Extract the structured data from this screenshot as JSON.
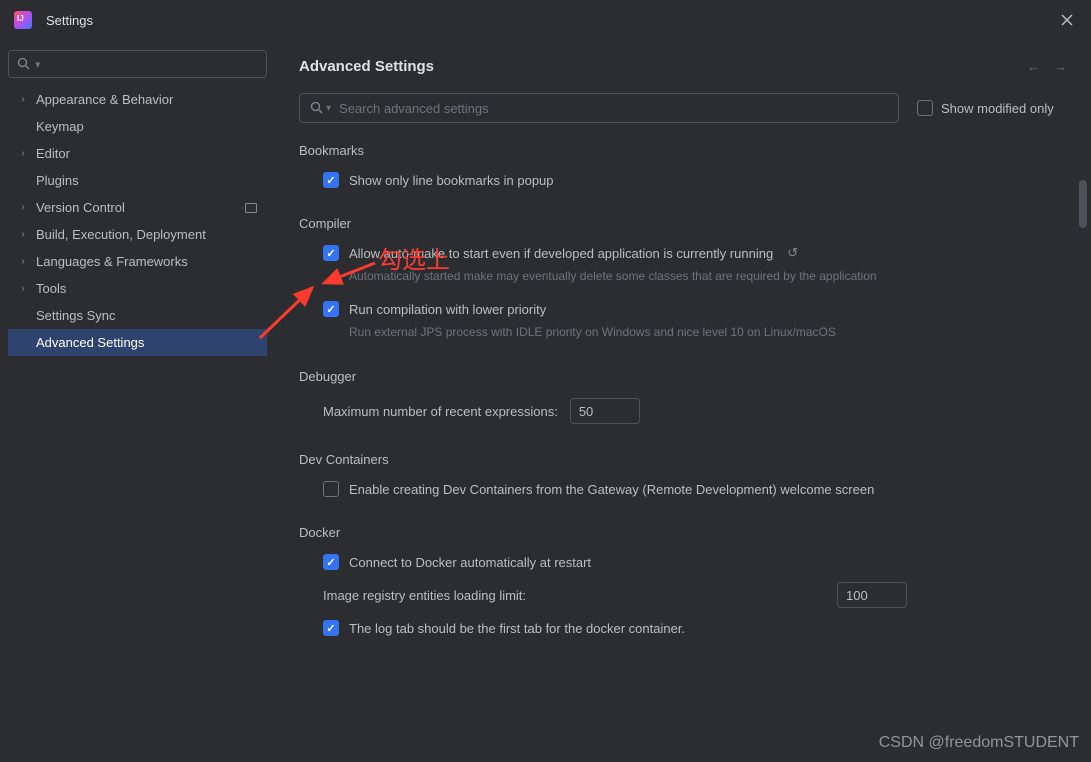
{
  "window": {
    "title": "Settings"
  },
  "sidebar": {
    "items": [
      {
        "label": "Appearance & Behavior",
        "expandable": true
      },
      {
        "label": "Keymap",
        "expandable": false
      },
      {
        "label": "Editor",
        "expandable": true
      },
      {
        "label": "Plugins",
        "expandable": false
      },
      {
        "label": "Version Control",
        "expandable": true,
        "badge": true
      },
      {
        "label": "Build, Execution, Deployment",
        "expandable": true
      },
      {
        "label": "Languages & Frameworks",
        "expandable": true
      },
      {
        "label": "Tools",
        "expandable": true
      },
      {
        "label": "Settings Sync",
        "expandable": false
      },
      {
        "label": "Advanced Settings",
        "expandable": false,
        "selected": true
      }
    ]
  },
  "content": {
    "title": "Advanced Settings",
    "search_placeholder": "Search advanced settings",
    "show_modified_only": "Show modified only",
    "sections": {
      "bookmarks": {
        "title": "Bookmarks",
        "show_line_bookmarks": "Show only line bookmarks in popup"
      },
      "compiler": {
        "title": "Compiler",
        "auto_make": "Allow auto-make to start even if developed application is currently running",
        "auto_make_hint": "Automatically started make may eventually delete some classes that are required by the application",
        "lower_priority": "Run compilation with lower priority",
        "lower_priority_hint": "Run external JPS process with IDLE priority on Windows and nice level 10 on Linux/macOS"
      },
      "debugger": {
        "title": "Debugger",
        "max_expr_label": "Maximum number of recent expressions:",
        "max_expr_value": "50"
      },
      "dev_containers": {
        "title": "Dev Containers",
        "enable_creating": "Enable creating Dev Containers from the Gateway (Remote Development) welcome screen"
      },
      "docker": {
        "title": "Docker",
        "connect_auto": "Connect to Docker automatically at restart",
        "registry_limit_label": "Image registry entities loading limit:",
        "registry_limit_value": "100",
        "log_tab_first": "The log tab should be the first tab for the docker container."
      }
    }
  },
  "annotation": {
    "text": "勾选上"
  },
  "watermark": "CSDN @freedomSTUDENT"
}
